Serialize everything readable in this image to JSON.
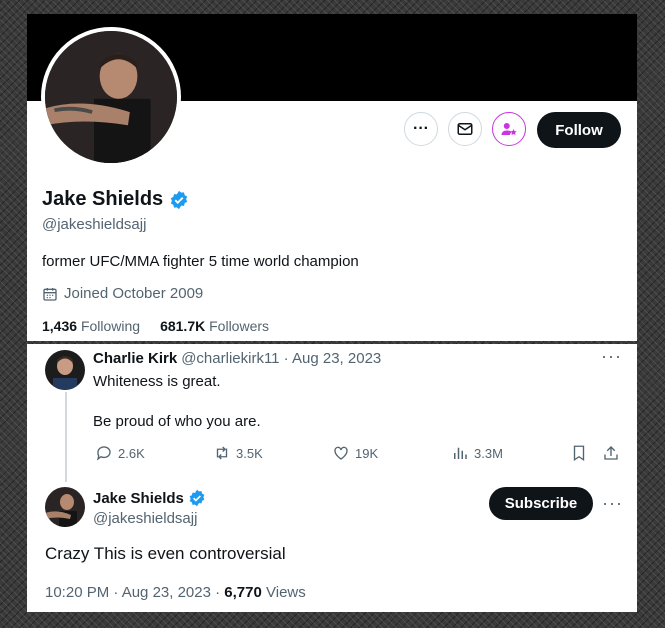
{
  "profile": {
    "name": "Jake Shields",
    "handle": "@jakeshieldsajj",
    "bio": "former UFC/MMA fighter 5 time world champion",
    "joined": "Joined October 2009",
    "following_count": "1,436",
    "following_label": "Following",
    "followers_count": "681.7K",
    "followers_label": "Followers",
    "follow_label": "Follow",
    "more_label": "···"
  },
  "original_tweet": {
    "name": "Charlie Kirk",
    "handle_date": "@charliekirk11 · Aug 23, 2023",
    "line1": "Whiteness is great.",
    "line2": "Be proud of who you are.",
    "replies": "2.6K",
    "retweets": "3.5K",
    "likes": "19K",
    "views": "3.3M",
    "more_label": "···"
  },
  "reply_tweet": {
    "name": "Jake Shields",
    "handle": "@jakeshieldsajj",
    "subscribe_label": "Subscribe",
    "text": "Crazy This is even controversial",
    "timestamp": "10:20 PM · Aug 23, 2023 · ",
    "views_count": "6,770",
    "views_label": "Views",
    "more_label": "···"
  },
  "colors": {
    "verified": "#1d9bf0",
    "subscribe_accent": "#c936e0",
    "text_primary": "#0f1419",
    "text_muted": "#536471"
  }
}
